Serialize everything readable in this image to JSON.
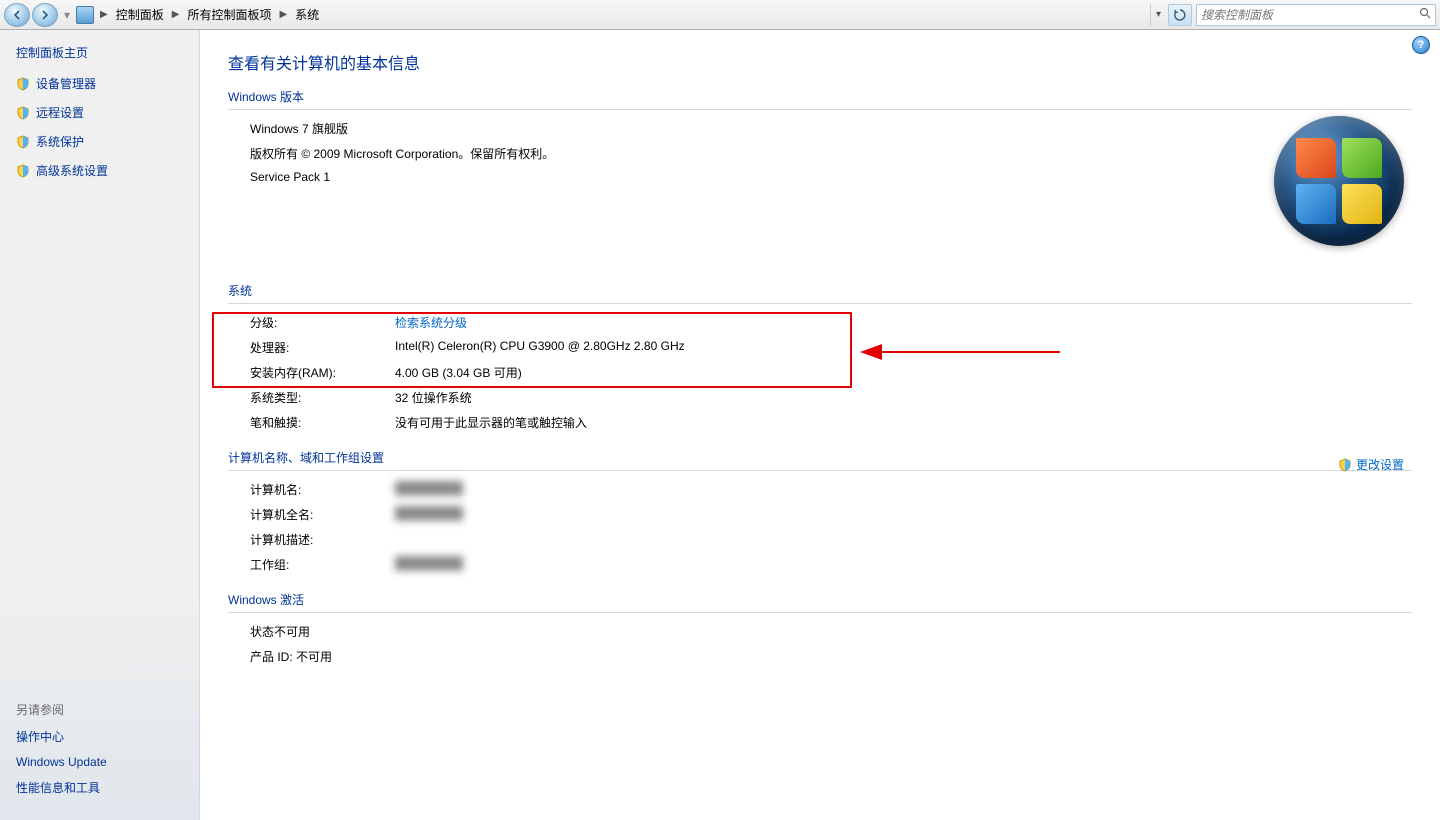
{
  "navbar": {
    "breadcrumb": [
      "控制面板",
      "所有控制面板项",
      "系统"
    ],
    "search_placeholder": "搜索控制面板"
  },
  "sidebar": {
    "home": "控制面板主页",
    "links": [
      {
        "label": "设备管理器"
      },
      {
        "label": "远程设置"
      },
      {
        "label": "系统保护"
      },
      {
        "label": "高级系统设置"
      }
    ],
    "seealso_title": "另请参阅",
    "seealso": [
      {
        "label": "操作中心"
      },
      {
        "label": "Windows Update"
      },
      {
        "label": "性能信息和工具"
      }
    ]
  },
  "content": {
    "title": "查看有关计算机的基本信息",
    "edition_header": "Windows 版本",
    "edition_name": "Windows 7 旗舰版",
    "copyright": "版权所有 © 2009 Microsoft Corporation。保留所有权利。",
    "service_pack": "Service Pack 1",
    "system_header": "系统",
    "rating_label": "分级:",
    "rating_link": "检索系统分级",
    "cpu_label": "处理器:",
    "cpu_value": "Intel(R) Celeron(R) CPU G3900 @ 2.80GHz   2.80 GHz",
    "ram_label": "安装内存(RAM):",
    "ram_value": "4.00 GB (3.04 GB 可用)",
    "systype_label": "系统类型:",
    "systype_value": "32 位操作系统",
    "pen_label": "笔和触摸:",
    "pen_value": "没有可用于此显示器的笔或触控输入",
    "domain_header": "计算机名称、域和工作组设置",
    "change_settings": "更改设置",
    "compname_label": "计算机名:",
    "compname_value": "████████",
    "fullname_label": "计算机全名:",
    "fullname_value": "████████",
    "desc_label": "计算机描述:",
    "desc_value": "",
    "workgroup_label": "工作组:",
    "workgroup_value": "████████",
    "activation_header": "Windows 激活",
    "act_status": "状态不可用",
    "act_pid": "产品 ID: 不可用"
  }
}
